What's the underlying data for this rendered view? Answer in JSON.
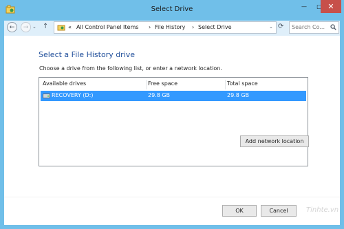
{
  "window": {
    "title": "Select Drive",
    "controls": {
      "minimize": "—",
      "maximize": "□",
      "close": "✕"
    }
  },
  "navigation": {
    "back": "←",
    "forward": "→",
    "dropdown": "⌄",
    "up": "↑",
    "breadcrumb": {
      "overflow": "«",
      "items": [
        "All Control Panel Items",
        "File History",
        "Select Drive"
      ],
      "separator": "›"
    },
    "address_dropdown": "⌄",
    "refresh": "⟳",
    "search_placeholder": "Search Co..."
  },
  "main": {
    "heading": "Select a File History drive",
    "instruction": "Choose a drive from the following list, or enter a network location.",
    "columns": [
      "Available drives",
      "Free space",
      "Total space"
    ],
    "drives": [
      {
        "name": "RECOVERY (D:)",
        "free_space": "29.8 GB",
        "total_space": "29.8 GB",
        "selected": true
      }
    ],
    "add_network_button": "Add network location"
  },
  "footer": {
    "ok_button": "OK",
    "cancel_button": "Cancel"
  },
  "watermark": "Tinhte.vn",
  "colors": {
    "frame": "#70bfe9",
    "selection": "#3399ff",
    "heading": "#1f4e9a",
    "close_button": "#c7504a"
  }
}
